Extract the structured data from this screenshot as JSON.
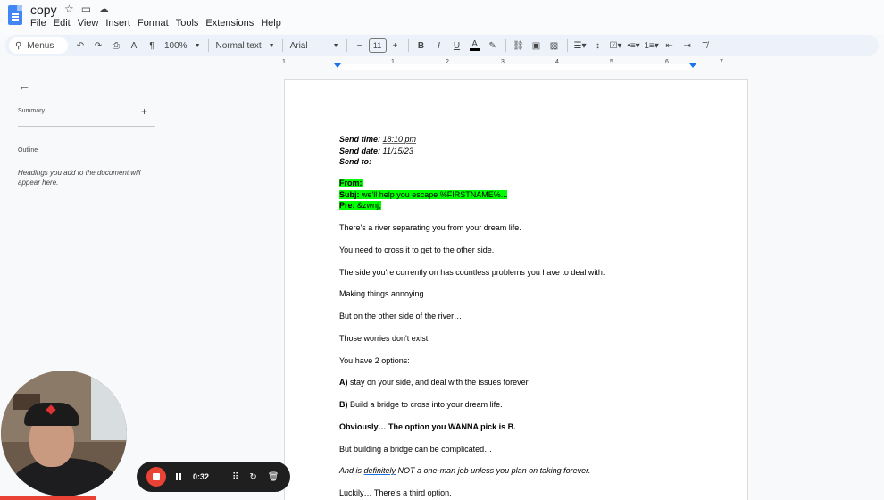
{
  "window": {
    "title": "copy",
    "menu": [
      "File",
      "Edit",
      "View",
      "Insert",
      "Format",
      "Tools",
      "Extensions",
      "Help"
    ]
  },
  "toolbar": {
    "menus_label": "Menus",
    "zoom": "100%",
    "style": "Normal text",
    "font": "Arial",
    "font_size": "11"
  },
  "ruler": {
    "numbers": [
      "1",
      "1",
      "2",
      "3",
      "4",
      "5",
      "6",
      "7"
    ]
  },
  "sidebar": {
    "summary_label": "Summary",
    "outline_label": "Outline",
    "outline_hint": "Headings you add to the document will appear here."
  },
  "document": {
    "send_time_label": "Send time:",
    "send_time_value": "18:10 pm",
    "send_date_label": "Send date:",
    "send_date_value": "11/15/23",
    "send_to_label": "Send to:",
    "from_label": "From:",
    "subj_label": "Subj:",
    "subj_value": "we'll help you escape %FIRSTNAME%...",
    "pre_label": "Pre:",
    "pre_value": "&zwnj;",
    "p1": "There's a river separating you from your dream life.",
    "p2": "You need to cross it to get to the other side.",
    "p3": "The side you're currently on has countless problems you have to deal with.",
    "p4": "Making things annoying.",
    "p5": "But on the other side of the river…",
    "p6": "Those worries don't exist.",
    "p7": "You have 2 options:",
    "p8_label": "A)",
    "p8_text": " stay on your side, and deal with the issues forever",
    "p9_label": "B)",
    "p9_text": " Build a bridge to cross into your dream life.",
    "p10": "Obviously… The option you WANNA pick is B.",
    "p11": "But building a bridge can be complicated…",
    "p12_a": "And is ",
    "p12_b": "definitely",
    "p12_c": " NOT a one-man job unless you plan on taking forever.",
    "p13": "Luckily… There's a third option."
  },
  "recorder": {
    "timer": "0:32"
  }
}
